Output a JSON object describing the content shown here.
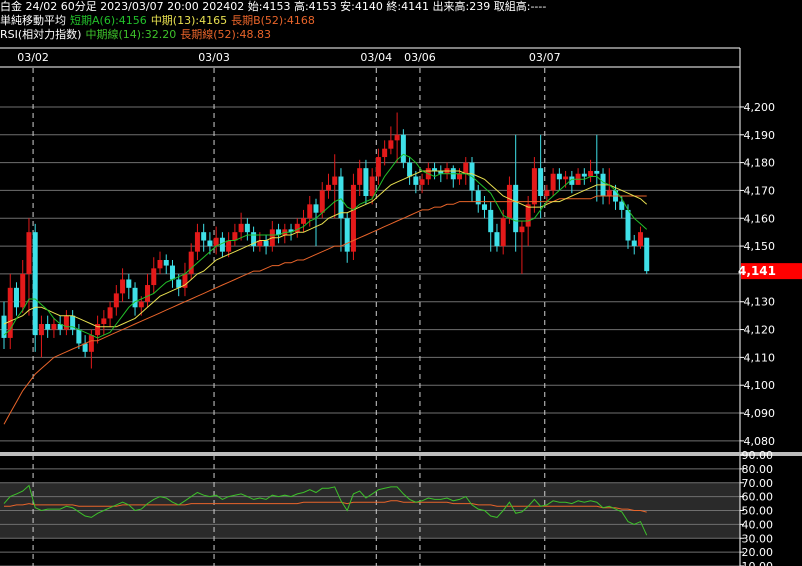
{
  "header": {
    "line1": "白金 24/02 60分足 2023/03/07 20:00 202402 始:4153 高:4153 安:4140 終:4141 出来高:239 取組高:----",
    "ma_title": "単純移動平均",
    "ma_short": "短期A(6):4156",
    "ma_mid": "中期(13):4165",
    "ma_long": "長期B(52):4168",
    "rsi_title": "RSI(相対力指数)",
    "rsi_mid": "中期線(14):32.20",
    "rsi_long": "長期線(52):48.83"
  },
  "colors": {
    "background": "#000000",
    "up_candle": "#e31a1a",
    "down_candle": "#3fe0e8",
    "ma_short": "#22c02a",
    "ma_mid": "#e8e050",
    "ma_long": "#e8642a",
    "rsi_mid": "#3dc12a",
    "rsi_long": "#e8642a",
    "price_tag": "#ff0000"
  },
  "chart_data": [
    {
      "type": "candlestick",
      "x_labels": [
        "03/02",
        "03/03",
        "03/04",
        "03/06",
        "03/07"
      ],
      "x_label_positions_bar_index": [
        4,
        33,
        59,
        66,
        86
      ],
      "ylim": [
        4076,
        4214
      ],
      "y_ticks": [
        4080,
        4090,
        4100,
        4110,
        4120,
        4130,
        4140,
        4150,
        4160,
        4170,
        4180,
        4190,
        4200
      ],
      "y_tick_labels": [
        "4,080",
        "4,090",
        "4,100",
        "4,110",
        "4,120",
        "4,130",
        "4,140",
        "4,150",
        "4,160",
        "4,170",
        "4,180",
        "4,190",
        "4,200"
      ],
      "last_price_label": "4,141",
      "last_price": 4141,
      "grid": true,
      "closes": [
        4117,
        4135,
        4128,
        4140,
        4155,
        4118,
        4122,
        4120,
        4122,
        4120,
        4125,
        4120,
        4115,
        4112,
        4118,
        4122,
        4124,
        4128,
        4133,
        4138,
        4135,
        4128,
        4130,
        4136,
        4142,
        4145,
        4143,
        4138,
        4135,
        4140,
        4148,
        4155,
        4152,
        4150,
        4153,
        4148,
        4152,
        4155,
        4158,
        4155,
        4150,
        4152,
        4150,
        4156,
        4154,
        4156,
        4155,
        4158,
        4160,
        4165,
        4162,
        4170,
        4172,
        4175,
        4160,
        4148,
        4172,
        4178,
        4168,
        4175,
        4182,
        4185,
        4188,
        4190,
        4180,
        4175,
        4172,
        4174,
        4178,
        4177,
        4176,
        4178,
        4174,
        4176,
        4180,
        4170,
        4165,
        4163,
        4155,
        4150,
        4160,
        4172,
        4155,
        4157,
        4165,
        4178,
        4168,
        4170,
        4176,
        4174,
        4175,
        4172,
        4176,
        4175,
        4177,
        4176,
        4168,
        4170,
        4166,
        4163,
        4152,
        4150,
        4155,
        4141
      ],
      "opens": [
        4125,
        4117,
        4135,
        4128,
        4140,
        4155,
        4118,
        4122,
        4120,
        4122,
        4120,
        4125,
        4120,
        4115,
        4112,
        4118,
        4122,
        4124,
        4128,
        4133,
        4138,
        4135,
        4128,
        4130,
        4136,
        4142,
        4145,
        4143,
        4138,
        4135,
        4140,
        4148,
        4155,
        4152,
        4150,
        4153,
        4148,
        4152,
        4155,
        4158,
        4155,
        4150,
        4152,
        4150,
        4156,
        4154,
        4156,
        4155,
        4158,
        4160,
        4165,
        4162,
        4170,
        4172,
        4175,
        4160,
        4148,
        4172,
        4178,
        4168,
        4175,
        4182,
        4185,
        4188,
        4190,
        4180,
        4175,
        4172,
        4174,
        4178,
        4177,
        4176,
        4178,
        4174,
        4176,
        4180,
        4170,
        4165,
        4163,
        4155,
        4150,
        4160,
        4172,
        4155,
        4157,
        4165,
        4178,
        4168,
        4170,
        4176,
        4174,
        4175,
        4172,
        4176,
        4175,
        4177,
        4176,
        4168,
        4170,
        4166,
        4163,
        4152,
        4150,
        4153
      ],
      "highs": [
        4130,
        4140,
        4137,
        4145,
        4160,
        4158,
        4125,
        4125,
        4124,
        4125,
        4127,
        4127,
        4122,
        4118,
        4120,
        4125,
        4127,
        4130,
        4136,
        4142,
        4140,
        4137,
        4132,
        4140,
        4146,
        4148,
        4147,
        4145,
        4140,
        4144,
        4151,
        4158,
        4158,
        4155,
        4157,
        4155,
        4155,
        4158,
        4162,
        4160,
        4157,
        4155,
        4154,
        4159,
        4158,
        4158,
        4158,
        4160,
        4163,
        4168,
        4167,
        4173,
        4176,
        4183,
        4178,
        4162,
        4176,
        4181,
        4181,
        4178,
        4185,
        4188,
        4193,
        4198,
        4192,
        4182,
        4177,
        4176,
        4180,
        4180,
        4179,
        4180,
        4179,
        4178,
        4182,
        4182,
        4172,
        4168,
        4166,
        4158,
        4163,
        4175,
        4190,
        4159,
        4168,
        4182,
        4190,
        4172,
        4178,
        4178,
        4177,
        4177,
        4178,
        4178,
        4181,
        4190,
        4178,
        4178,
        4172,
        4168,
        4165,
        4154,
        4157,
        4153
      ],
      "lows": [
        4113,
        4113,
        4125,
        4126,
        4125,
        4112,
        4110,
        4117,
        4117,
        4118,
        4118,
        4118,
        4113,
        4110,
        4106,
        4115,
        4118,
        4121,
        4125,
        4130,
        4131,
        4125,
        4125,
        4128,
        4133,
        4140,
        4140,
        4135,
        4132,
        4132,
        4138,
        4145,
        4148,
        4147,
        4147,
        4146,
        4146,
        4150,
        4152,
        4152,
        4148,
        4148,
        4147,
        4148,
        4151,
        4151,
        4152,
        4153,
        4155,
        4157,
        4150,
        4160,
        4167,
        4160,
        4148,
        4144,
        4145,
        4168,
        4165,
        4165,
        4172,
        4179,
        4183,
        4180,
        4178,
        4172,
        4169,
        4169,
        4172,
        4174,
        4173,
        4174,
        4171,
        4172,
        4172,
        4166,
        4162,
        4160,
        4148,
        4148,
        4147,
        4158,
        4148,
        4140,
        4150,
        4162,
        4160,
        4165,
        4168,
        4170,
        4171,
        4169,
        4172,
        4172,
        4173,
        4166,
        4165,
        4165,
        4163,
        4160,
        4149,
        4147,
        4149,
        4140
      ],
      "ma_short": [
        4118,
        4120,
        4124,
        4127,
        4131,
        4131,
        4129,
        4127,
        4124,
        4122,
        4121,
        4121,
        4120,
        4119,
        4118,
        4117,
        4118,
        4119,
        4122,
        4125,
        4128,
        4130,
        4131,
        4132,
        4133,
        4135,
        4137,
        4138,
        4139,
        4140,
        4142,
        4144,
        4146,
        4148,
        4150,
        4151,
        4152,
        4152,
        4153,
        4154,
        4154,
        4154,
        4154,
        4154,
        4154,
        4155,
        4155,
        4156,
        4157,
        4159,
        4160,
        4162,
        4164,
        4166,
        4167,
        4164,
        4163,
        4165,
        4166,
        4167,
        4171,
        4175,
        4178,
        4181,
        4183,
        4182,
        4180,
        4177,
        4176,
        4175,
        4176,
        4176,
        4176,
        4176,
        4176,
        4175,
        4173,
        4171,
        4169,
        4165,
        4161,
        4160,
        4159,
        4159,
        4159,
        4160,
        4163,
        4166,
        4168,
        4170,
        4172,
        4174,
        4174,
        4174,
        4175,
        4175,
        4173,
        4172,
        4170,
        4167,
        4163,
        4160,
        4158,
        4156
      ],
      "ma_mid": [
        4122,
        4123,
        4124,
        4125,
        4127,
        4128,
        4128,
        4127,
        4126,
        4125,
        4125,
        4125,
        4124,
        4123,
        4122,
        4121,
        4121,
        4121,
        4121,
        4122,
        4123,
        4124,
        4126,
        4128,
        4130,
        4132,
        4133,
        4134,
        4135,
        4136,
        4138,
        4140,
        4141,
        4143,
        4145,
        4146,
        4147,
        4148,
        4149,
        4150,
        4151,
        4152,
        4152,
        4153,
        4153,
        4154,
        4154,
        4155,
        4155,
        4156,
        4157,
        4158,
        4160,
        4161,
        4162,
        4162,
        4163,
        4164,
        4165,
        4166,
        4168,
        4170,
        4172,
        4173,
        4174,
        4175,
        4176,
        4177,
        4177,
        4177,
        4177,
        4177,
        4177,
        4177,
        4176,
        4176,
        4175,
        4174,
        4172,
        4170,
        4168,
        4167,
        4166,
        4165,
        4164,
        4164,
        4164,
        4165,
        4166,
        4166,
        4167,
        4168,
        4169,
        4170,
        4171,
        4172,
        4172,
        4172,
        4171,
        4170,
        4169,
        4168,
        4167,
        4165
      ],
      "ma_long": [
        4086,
        4090,
        4094,
        4098,
        4101,
        4104,
        4106,
        4108,
        4110,
        4111,
        4112,
        4113,
        4114,
        4115,
        4116,
        4116,
        4117,
        4118,
        4119,
        4120,
        4121,
        4122,
        4123,
        4124,
        4125,
        4126,
        4127,
        4128,
        4129,
        4130,
        4131,
        4132,
        4133,
        4134,
        4135,
        4136,
        4137,
        4138,
        4139,
        4140,
        4141,
        4141,
        4142,
        4143,
        4143,
        4144,
        4144,
        4145,
        4145,
        4146,
        4147,
        4148,
        4149,
        4150,
        4150,
        4151,
        4152,
        4153,
        4154,
        4155,
        4156,
        4157,
        4158,
        4159,
        4160,
        4161,
        4162,
        4163,
        4163,
        4164,
        4164,
        4165,
        4165,
        4166,
        4166,
        4166,
        4166,
        4166,
        4166,
        4166,
        4166,
        4166,
        4166,
        4166,
        4166,
        4166,
        4166,
        4166,
        4166,
        4167,
        4167,
        4167,
        4167,
        4167,
        4167,
        4168,
        4168,
        4168,
        4168,
        4168,
        4168,
        4168,
        4168,
        4168
      ]
    },
    {
      "type": "line",
      "ylim": [
        10,
        90
      ],
      "y_ticks": [
        10,
        20,
        30,
        40,
        50,
        60,
        70,
        80,
        90
      ],
      "y_tick_labels": [
        "10.00",
        "20.00",
        "30.00",
        "40.00",
        "50.00",
        "60.00",
        "70.00",
        "80.00",
        "90.00"
      ],
      "bands": [
        [
          30,
          70
        ]
      ],
      "series": [
        {
          "name": "中期線(14)",
          "values": [
            55,
            60,
            62,
            64,
            68,
            52,
            50,
            51,
            51,
            51,
            53,
            52,
            49,
            46,
            45,
            48,
            50,
            52,
            54,
            56,
            54,
            50,
            51,
            55,
            58,
            60,
            59,
            56,
            54,
            57,
            60,
            63,
            61,
            60,
            61,
            58,
            60,
            61,
            62,
            60,
            58,
            59,
            58,
            61,
            60,
            61,
            60,
            62,
            63,
            65,
            63,
            66,
            66,
            67,
            57,
            50,
            62,
            64,
            59,
            62,
            65,
            66,
            67,
            67,
            62,
            58,
            56,
            57,
            59,
            58,
            58,
            59,
            57,
            58,
            60,
            54,
            51,
            50,
            46,
            45,
            50,
            56,
            48,
            49,
            53,
            58,
            53,
            54,
            57,
            56,
            56,
            55,
            57,
            56,
            57,
            56,
            52,
            53,
            51,
            49,
            42,
            40,
            42,
            32.2
          ]
        },
        {
          "name": "長期線(52)",
          "values": [
            53,
            53,
            54,
            54,
            55,
            54,
            54,
            54,
            54,
            54,
            54,
            54,
            53,
            53,
            53,
            53,
            53,
            53,
            53,
            54,
            54,
            54,
            54,
            54,
            54,
            54,
            54,
            54,
            54,
            54,
            55,
            55,
            55,
            55,
            55,
            55,
            55,
            55,
            55,
            55,
            55,
            55,
            55,
            55,
            55,
            55,
            55,
            55,
            56,
            56,
            56,
            56,
            56,
            56,
            56,
            55,
            56,
            56,
            56,
            56,
            56,
            56,
            57,
            57,
            56,
            56,
            56,
            56,
            56,
            56,
            56,
            56,
            55,
            55,
            55,
            55,
            54,
            54,
            54,
            53,
            53,
            53,
            53,
            53,
            53,
            53,
            53,
            53,
            53,
            53,
            53,
            53,
            53,
            53,
            53,
            53,
            52,
            52,
            52,
            51,
            51,
            50,
            50,
            48.83
          ]
        }
      ]
    }
  ]
}
